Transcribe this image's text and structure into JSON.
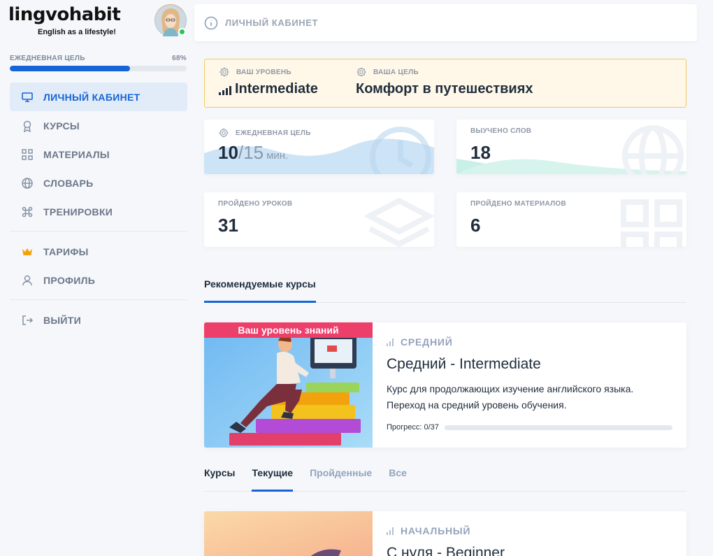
{
  "brand": {
    "name": "lingvohabit",
    "tagline": "English as a lifestyle!"
  },
  "daily_goal": {
    "label": "ЕЖЕДНЕВНАЯ ЦЕЛЬ",
    "percent_text": "68%",
    "percent": 68
  },
  "nav": {
    "main": [
      {
        "label": "ЛИЧНЫЙ КАБИНЕТ",
        "icon": "monitor-icon",
        "active": true
      },
      {
        "label": "КУРСЫ",
        "icon": "award-icon"
      },
      {
        "label": "МАТЕРИАЛЫ",
        "icon": "grid-icon"
      },
      {
        "label": "СЛОВАРЬ",
        "icon": "globe-icon"
      },
      {
        "label": "ТРЕНИРОВКИ",
        "icon": "command-icon"
      }
    ],
    "secondary": [
      {
        "label": "ТАРИФЫ",
        "icon": "crown-icon"
      },
      {
        "label": "ПРОФИЛЬ",
        "icon": "user-icon"
      }
    ],
    "logout": {
      "label": "ВЫЙТИ",
      "icon": "logout-icon"
    }
  },
  "header": {
    "title": "ЛИЧНЫЙ КАБИНЕТ"
  },
  "level_card": {
    "level_label": "ВАШ УРОВЕНЬ",
    "level_value": "Intermediate",
    "goal_label": "ВАША ЦЕЛЬ",
    "goal_value": "Комфорт в путешествиях"
  },
  "stats": {
    "daily": {
      "label": "ЕЖЕДНЕВНАЯ ЦЕЛЬ",
      "done": "10",
      "total": "/15",
      "unit": "мин."
    },
    "words": {
      "label": "ВЫУЧЕНО СЛОВ",
      "value": "18"
    },
    "lessons": {
      "label": "ПРОЙДЕНО УРОКОВ",
      "value": "31"
    },
    "materials": {
      "label": "ПРОЙДЕНО МАТЕРИАЛОВ",
      "value": "6"
    }
  },
  "recommended": {
    "tab": "Рекомендуемые курсы",
    "course": {
      "badge": "Ваш уровень знаний",
      "level": "СРЕДНИЙ",
      "title": "Средний - Intermediate",
      "description": "Курс для продолжающих изучение английского языка. Переход на средний уровень обучения.",
      "progress_label": "Прогресс: 0/37",
      "progress": 0
    }
  },
  "course_tabs": [
    {
      "label": "Курсы",
      "state": "normal"
    },
    {
      "label": "Текущие",
      "state": "active"
    },
    {
      "label": "Пройденные",
      "state": "inactive"
    },
    {
      "label": "Все",
      "state": "inactive"
    }
  ],
  "current_course": {
    "level": "НАЧАЛЬНЫЙ",
    "title": "С нуля - Beginner"
  },
  "colors": {
    "accent": "#1565d8",
    "badge": "#ec3f6a",
    "level_card_bg": "#fff8e8",
    "level_card_border": "#f3c959"
  }
}
